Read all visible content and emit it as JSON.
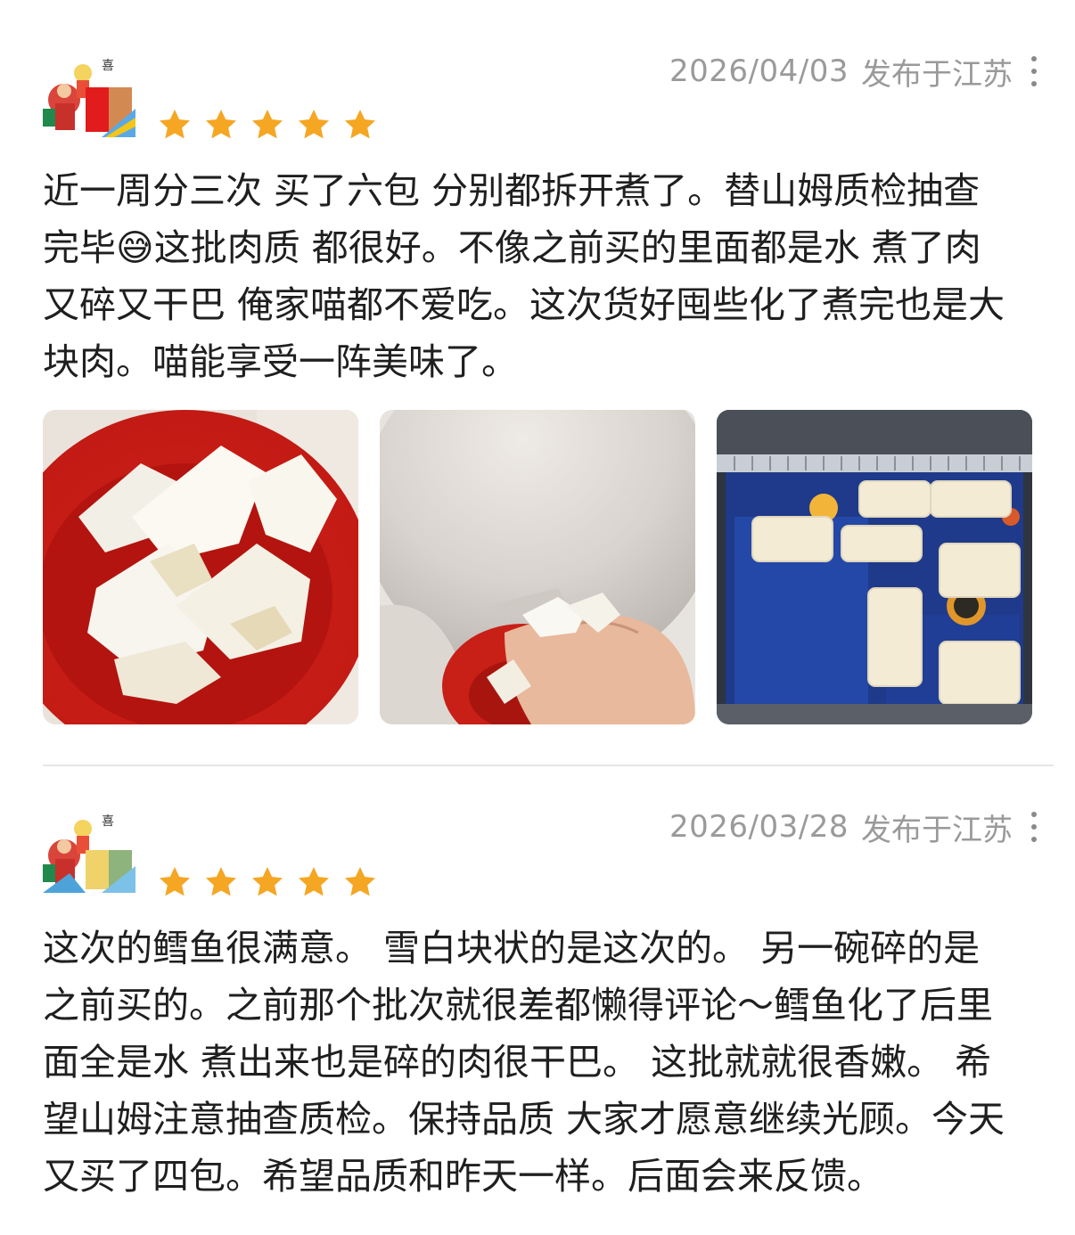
{
  "reviews": [
    {
      "date": "2026/04/03",
      "location": "发布于江苏",
      "rating": 5,
      "text": "近一周分三次 买了六包 分别都拆开煮了。替山姆质检抽查完毕😅这批肉质 都很好。不像之前买的里面都是水 煮了肉又碎又干巴 俺家喵都不爱吃。这次货好囤些化了煮完也是大块肉。喵能享受一阵美味了。",
      "photos": [
        "cooked-cod-bowl-photo",
        "cat-eating-photo",
        "frozen-cod-packs-photo"
      ]
    },
    {
      "date": "2026/03/28",
      "location": "发布于江苏",
      "rating": 5,
      "text": "这次的鳕鱼很满意。 雪白块状的是这次的。 另一碗碎的是之前买的。之前那个批次就很差都懒得评论～鳕鱼化了后里面全是水 煮出来也是碎的肉很干巴。 这批就就很香嫩。 希望山姆注意抽查质检。保持品质 大家才愿意继续光顾。今天又买了四包。希望品质和昨天一样。后面会来反馈。"
    }
  ],
  "colors": {
    "star": "#f5a623",
    "meta_text": "#9a9a9a",
    "divider": "#e6e6e6"
  },
  "icons": {
    "star": "star-icon",
    "more": "more-vertical-icon"
  }
}
